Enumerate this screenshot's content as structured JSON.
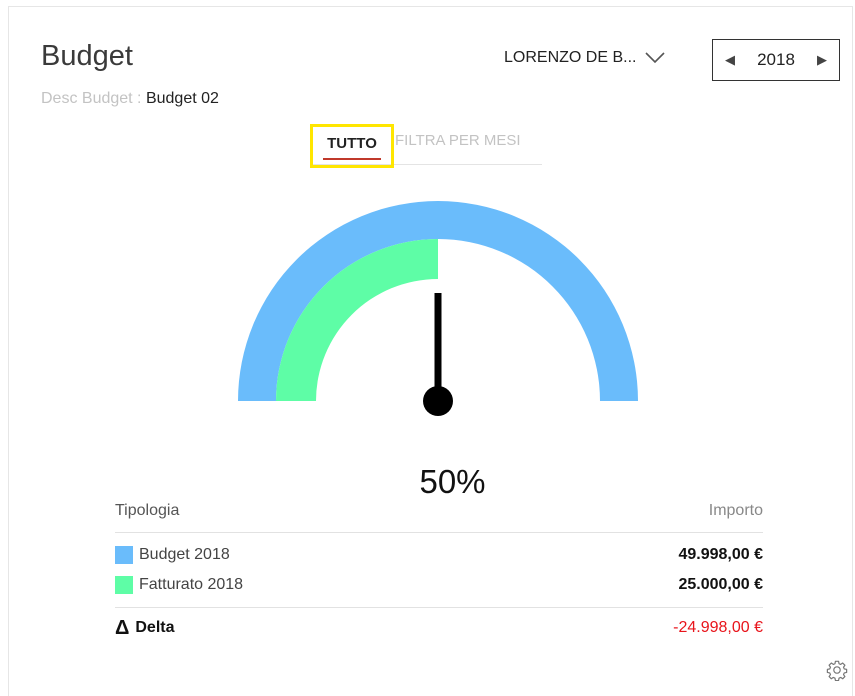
{
  "header": {
    "title": "Budget",
    "desc_label": "Desc Budget :",
    "desc_value": "Budget 02",
    "user_select": "LORENZO DE B...",
    "year": "2018"
  },
  "tabs": [
    {
      "label": "TUTTO",
      "active": true
    },
    {
      "label": "FILTRA PER MESI",
      "active": false
    }
  ],
  "gauge": {
    "percent_label": "50%",
    "outer_fraction": 1.0,
    "inner_fraction": 0.5,
    "outer_color": "#6abcfb",
    "inner_color": "#5efda6",
    "needle_color": "#000000"
  },
  "table": {
    "col_type": "Tipologia",
    "col_amount": "Importo",
    "rows": [
      {
        "label": "Budget 2018",
        "amount": "49.998,00 €",
        "color": "#6abcfb"
      },
      {
        "label": "Fatturato 2018",
        "amount": "25.000,00 €",
        "color": "#5efda6"
      }
    ],
    "delta_label": "Delta",
    "delta_amount": "-24.998,00 €",
    "delta_color": "#e8141b"
  },
  "icons": {
    "chevron": "chevron-down-icon",
    "prev": "arrow-left-icon",
    "next": "arrow-right-icon",
    "settings": "gear-icon"
  }
}
